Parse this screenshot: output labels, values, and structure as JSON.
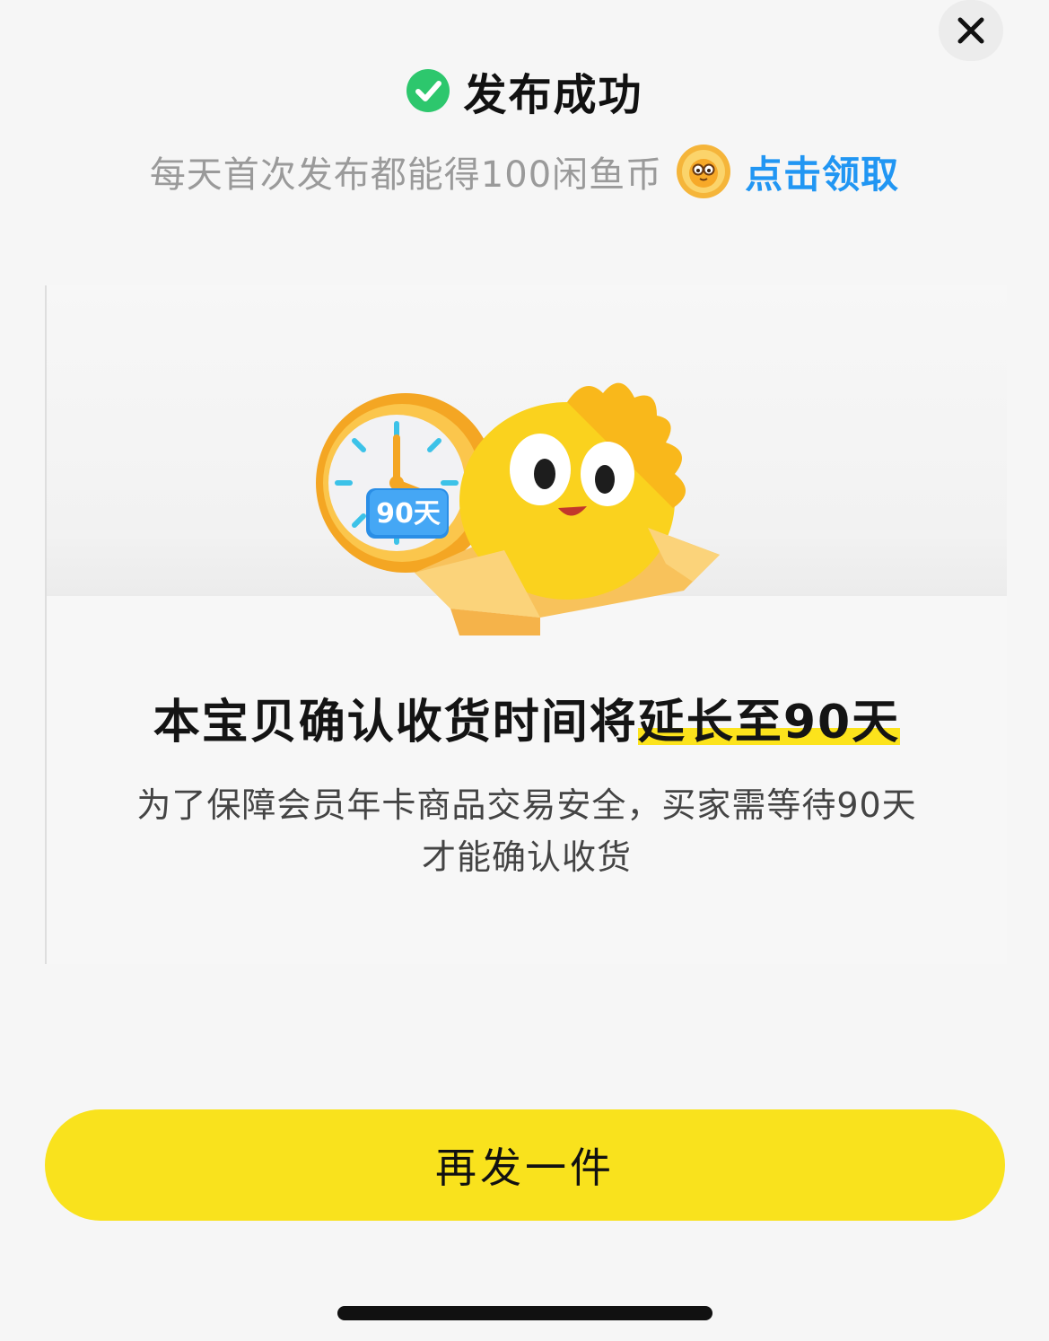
{
  "header": {
    "title": "发布成功",
    "coin_text": "每天首次发布都能得100闲鱼币",
    "claim_link": "点击领取"
  },
  "card": {
    "badge": "90天",
    "title_prefix": "本宝贝确认收货时间将",
    "title_highlight": "延长至90天",
    "description_line1": "为了保障会员年卡商品交易安全，买家需等待90天",
    "description_line2": "才能确认收货"
  },
  "actions": {
    "publish_again_label": "再发一件"
  },
  "colors": {
    "accent_yellow": "#f9e21d",
    "link_blue": "#2196f3",
    "success_green": "#2dc76d"
  },
  "icons": [
    "close-icon",
    "check-circle-icon",
    "xianyu-coin-icon",
    "clock-mascot-illustration"
  ]
}
